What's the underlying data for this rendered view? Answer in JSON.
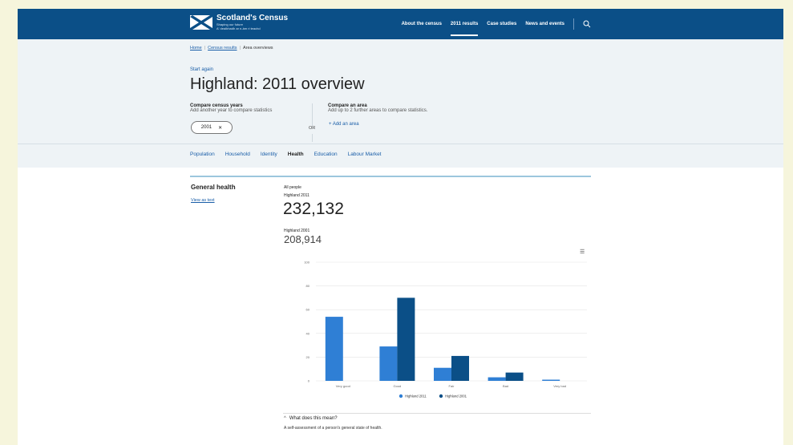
{
  "brand": {
    "name": "Scotland's Census",
    "tagline1": "Shaping our future",
    "tagline2": "A' dealbhadh ar n-àm ri teachd"
  },
  "nav": {
    "items": [
      "About the census",
      "2011 results",
      "Case studies",
      "News and events"
    ],
    "active": "2011 results"
  },
  "breadcrumb": [
    "Home",
    "Census results",
    "Area overviews"
  ],
  "start_again": "Start again",
  "title": "Highland: 2011 overview",
  "compare_years": {
    "heading": "Compare census years",
    "sub": "Add another year to compare statistics",
    "chip": "2001"
  },
  "or": "OR",
  "compare_area": {
    "heading": "Compare an area",
    "sub": "Add up to 2 further areas to compare statistics.",
    "add": "+ Add an area"
  },
  "tabs": [
    "Population",
    "Household",
    "Identity",
    "Health",
    "Education",
    "Labour Market"
  ],
  "active_tab": "Health",
  "section": {
    "title": "General health",
    "view_as_text": "View as text",
    "all_people": "All people",
    "label1": "Highland 2011",
    "value1": "232,132",
    "label2": "Highland 2001",
    "value2": "208,914"
  },
  "colors": {
    "series2011": "#2f7fd5",
    "series2001": "#0b4f87"
  },
  "chart_data": {
    "type": "bar",
    "categories": [
      "Very good",
      "Good",
      "Fair",
      "Bad",
      "Very bad"
    ],
    "series": [
      {
        "name": "Highland 2011",
        "values": [
          54,
          29,
          11,
          3,
          1
        ]
      },
      {
        "name": "Highland 2001",
        "values": [
          0,
          70,
          21,
          7,
          0
        ]
      }
    ],
    "ylim": [
      0,
      100
    ],
    "yticks": [
      0,
      20,
      40,
      60,
      80,
      100
    ],
    "grid": true,
    "legend": "bottom"
  },
  "what_does_this_mean": "What does this mean?",
  "explanation": "A self-assessment of a person's general state of health."
}
